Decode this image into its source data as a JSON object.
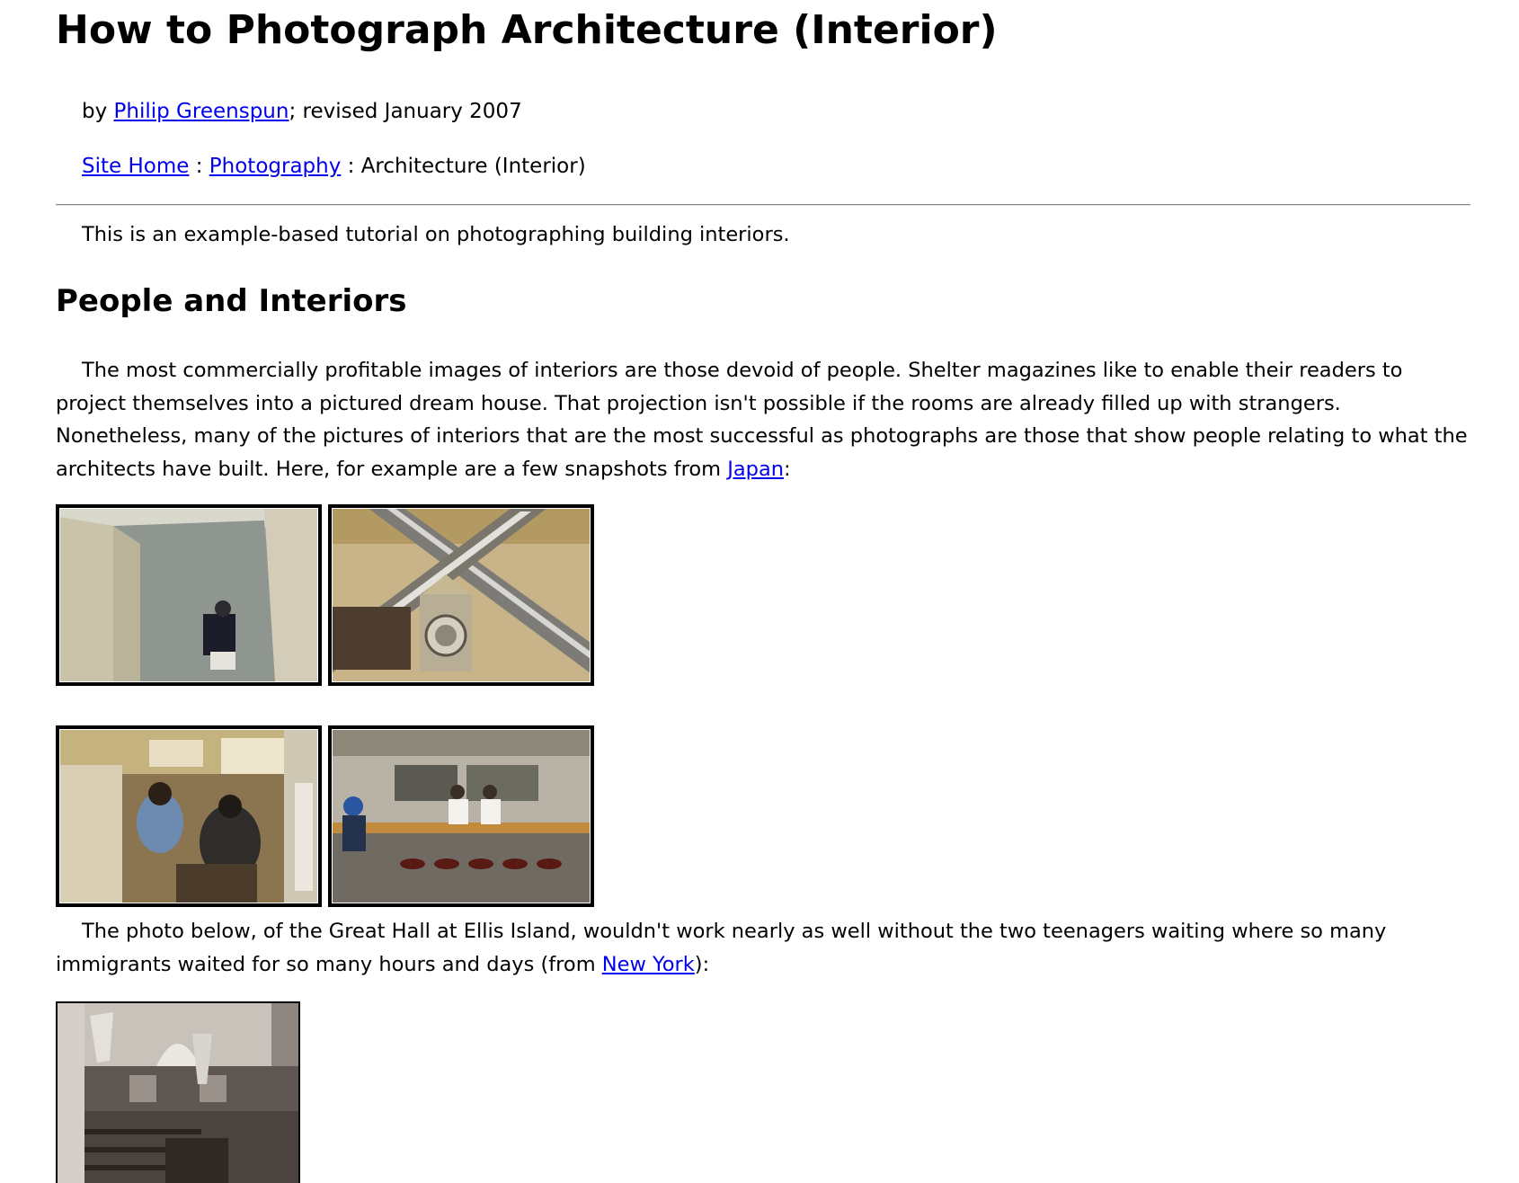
{
  "header": {
    "title": "How to Photograph Architecture (Interior)"
  },
  "byline": {
    "prefix": "by ",
    "author": "Philip Greenspun",
    "suffix": "; revised January 2007"
  },
  "breadcrumb": {
    "items": [
      "Site Home",
      "Photography"
    ],
    "separator": " : ",
    "current": "Architecture (Interior)"
  },
  "intro": "This is an example-based tutorial on photographing building interiors.",
  "section": {
    "heading": "People and Interiors",
    "para1_text": "The most commercially profitable images of interiors are those devoid of people. Shelter magazines like to enable their readers to project themselves into a pictured dream house. That projection isn't possible if the rooms are already filled up with strangers. Nonetheless, many of the pictures of interiors that are the most successful as photographs are those that show people relating to what the architects have built. Here, for example are a few snapshots from ",
    "para1_link": "Japan",
    "para1_end": ":",
    "para2_text": "The photo below, of the Great Hall at Ellis Island, wouldn't work nearly as well without the two teenagers waiting where so many immigrants waited for so many hours and days (from ",
    "para2_link": "New York",
    "para2_end": "):"
  },
  "photos": [
    {
      "subject": "concrete stairwell with seated person"
    },
    {
      "subject": "escalators with clock tower"
    },
    {
      "subject": "crowded noodle shop counter"
    },
    {
      "subject": "ramen bar with stools"
    },
    {
      "subject": "Great Hall at Ellis Island"
    }
  ],
  "colors": {
    "link": "#0000ee",
    "text": "#000000",
    "rule": "#888888"
  }
}
